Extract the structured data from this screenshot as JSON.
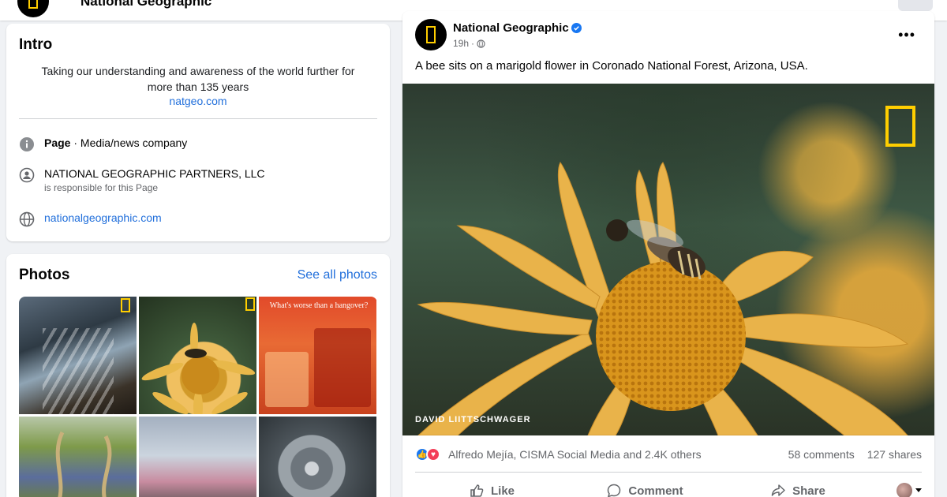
{
  "topbar": {
    "page_name": "National Geographic"
  },
  "intro": {
    "title": "Intro",
    "bio_line1": "Taking our understanding and awareness of the world further for",
    "bio_line2": "more than 135 years",
    "bio_link": "natgeo.com",
    "category_label": "Page",
    "category_value": " · Media/news company",
    "owner_name": "NATIONAL GEOGRAPHIC PARTNERS, LLC",
    "owner_note": "is responsible for this Page",
    "website": "nationalgeographic.com"
  },
  "photos": {
    "title": "Photos",
    "see_all": "See all photos",
    "items": [
      {
        "name": "coastal-waterfall"
      },
      {
        "name": "bee-on-flower"
      },
      {
        "name": "hangover-drinks",
        "caption": "What's worse than a hangover?"
      },
      {
        "name": "bluebonnet-field"
      },
      {
        "name": "cherry-blossoms"
      },
      {
        "name": "whale-eye"
      }
    ]
  },
  "post": {
    "page_name": "National Geographic",
    "time": "19h",
    "time_separator": "·",
    "caption": "A bee sits on a marigold flower in Coronado National Forest, Arizona, USA.",
    "photo_credit": "DAVID LIITTSCHWAGER",
    "reactors": "Alfredo Mejía, CISMA Social Media and 2.4K others",
    "comments": "58 comments",
    "shares": "127 shares",
    "actions": {
      "like": "Like",
      "comment": "Comment",
      "share": "Share"
    }
  },
  "colors": {
    "link_blue": "#216fdb",
    "natgeo_yellow": "#ffce00",
    "background": "#f0f2f5"
  }
}
